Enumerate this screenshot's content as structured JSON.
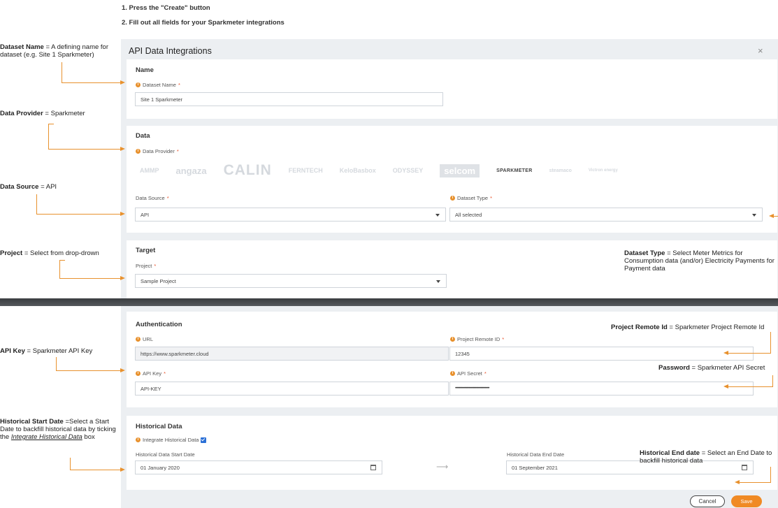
{
  "instructions": {
    "step1": "1. Press the \"Create\" button",
    "step2": "2. Fill out all fields for your Sparkmeter integrations"
  },
  "annotations": {
    "dataset_name_bold": "Dataset Name",
    "dataset_name_rest": " = A defining name for dataset (e.g. Site 1 Sparkmeter)",
    "data_provider_bold": "Data Provider",
    "data_provider_rest": " = Sparkmeter",
    "data_source_bold": "Data Source",
    "data_source_rest": " = API",
    "project_bold": "Project",
    "project_rest": " = Select from drop-drown",
    "dataset_type_bold": "Dataset Type",
    "dataset_type_rest": " = Select Meter Metrics for Consumption data (and/or) Electricity Payments for Payment data",
    "project_remote_bold": "Project Remote Id",
    "project_remote_rest": " = Sparkmeter Project Remote Id",
    "api_key_bold": "API Key",
    "api_key_rest": " = Sparkmeter API Key",
    "password_bold": "Password",
    "password_rest": " = Sparkmeter API Secret",
    "hist_start_bold": "Historical Start Date",
    "hist_start_rest": " =Select a Start Date to backfill historical data by ticking the ",
    "hist_start_link": "Integrate Historical Data",
    "hist_start_tail": " box",
    "hist_end_bold": "Historical End date",
    "hist_end_rest": " = Select an End Date to backfill historical data"
  },
  "modal": {
    "title": "API Data Integrations",
    "close": "×",
    "name_section": {
      "title": "Name",
      "dataset_name_label": "Dataset Name",
      "dataset_name_value": "Site 1 Sparkmeter"
    },
    "data_section": {
      "title": "Data",
      "provider_label": "Data Provider",
      "providers": [
        "AMMP",
        "angaza",
        "CALIN",
        "FERNTECH",
        "KeloBasbox",
        "ODYSSEY",
        "selcom",
        "SPARKMETER",
        "steamaco",
        "Victron energy"
      ],
      "data_source_label": "Data Source",
      "data_source_value": "API",
      "dataset_type_label": "Dataset Type",
      "dataset_type_value": "All selected"
    },
    "target_section": {
      "title": "Target",
      "project_label": "Project",
      "project_value": "Sample Project"
    },
    "auth_section": {
      "title": "Authentication",
      "url_label": "URL",
      "url_value": "https://www.sparkmeter.cloud",
      "remote_id_label": "Project Remote ID",
      "remote_id_value": "12345",
      "api_key_label": "API Key",
      "api_key_value": "API-KEY",
      "api_secret_label": "API Secret",
      "api_secret_value": "••••••••••••••••••••••••••••••••••••••••••••"
    },
    "historical_section": {
      "title": "Historical Data",
      "integrate_label": "Integrate Historical Data",
      "start_label": "Historical Data Start Date",
      "start_value": "01 January 2020",
      "end_label": "Historical Data End Date",
      "end_value": "01 September 2021",
      "range_arrow": "⟶"
    },
    "buttons": {
      "cancel": "Cancel",
      "save": "Save"
    }
  },
  "colors": {
    "accent": "#f08a24",
    "arrow": "#e8912d",
    "panel": "#eceff2",
    "checkbox": "#2a6fd6"
  }
}
